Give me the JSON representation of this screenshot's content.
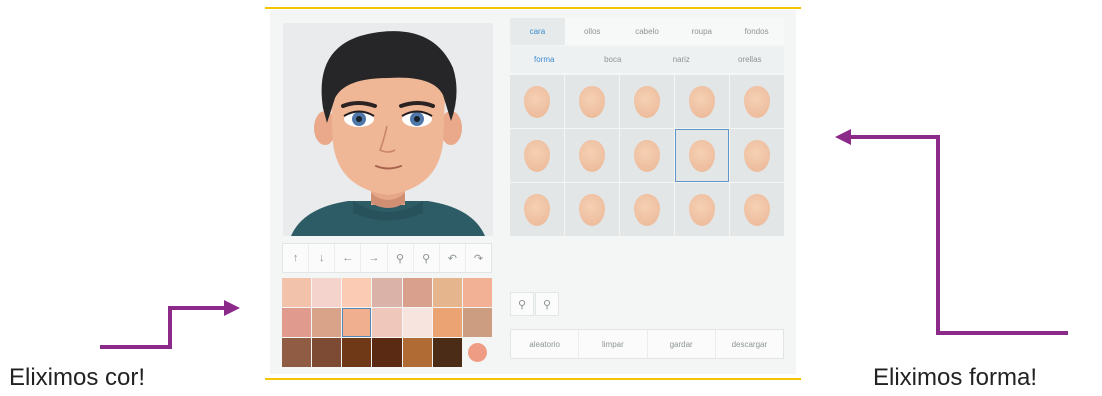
{
  "toolbar": {
    "icons": [
      "arrow-up-icon",
      "arrow-down-icon",
      "arrow-left-icon",
      "arrow-right-icon",
      "zoom-out-icon",
      "zoom-in-icon",
      "undo-icon",
      "redo-icon"
    ],
    "glyphs": [
      "↑",
      "↓",
      "←",
      "→",
      "⚲",
      "⚲",
      "↶",
      "↷"
    ]
  },
  "tabs": [
    {
      "label": "cara",
      "active": true
    },
    {
      "label": "ollos",
      "active": false
    },
    {
      "label": "cabelo",
      "active": false
    },
    {
      "label": "roupa",
      "active": false
    },
    {
      "label": "fondos",
      "active": false
    }
  ],
  "subtabs": [
    {
      "label": "forma",
      "active": true
    },
    {
      "label": "boca",
      "active": false
    },
    {
      "label": "nariz",
      "active": false
    },
    {
      "label": "orellas",
      "active": false
    }
  ],
  "face_grid": {
    "rows": 3,
    "cols": 5,
    "selected_index": 8
  },
  "skin_colors": [
    "#f2c3aa",
    "#f3d3cc",
    "#fccbb3",
    "#dbb2a7",
    "#d9a18d",
    "#e5b58d",
    "#f2b095",
    "#e09a8e",
    "#d9a389",
    "#f0b090",
    "#efc7bb",
    "#f7e4df",
    "#eca373",
    "#cd9d82",
    "#905c44",
    "#7d4a33",
    "#6f3817",
    "#5b2a12",
    "#b06a34",
    "#4a2c17",
    "#ee9d84"
  ],
  "skin_selected_index": 9,
  "zoom_glyphs": [
    "⚲",
    "⚲"
  ],
  "actions": [
    "aleatorio",
    "limpar",
    "gardar",
    "descargar"
  ],
  "captions": {
    "left": "Eliximos cor!",
    "right": "Eliximos forma!"
  },
  "colors": {
    "accent": "#f2c500",
    "arrow": "#8c2a8a",
    "tab_active": "#3d8bd0"
  }
}
